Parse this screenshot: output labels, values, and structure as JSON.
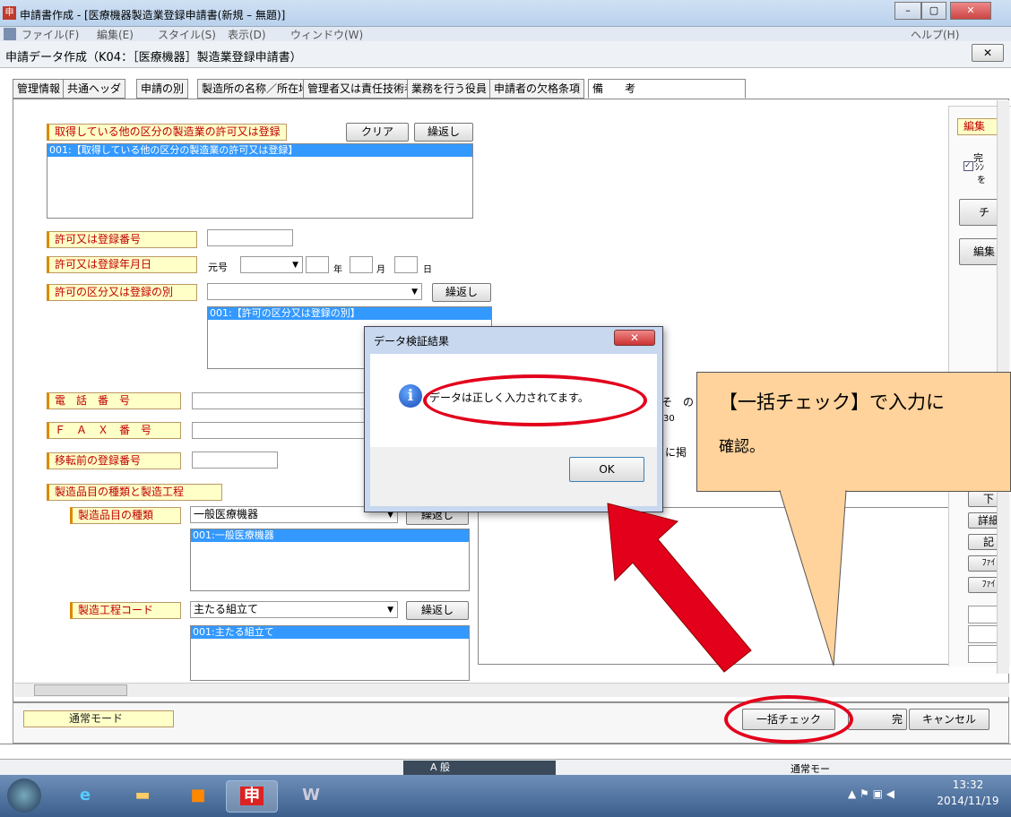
{
  "window": {
    "app_icon": "申",
    "title": "申請書作成 - [医療機器製造業登録申請書(新規 – 無題)]",
    "minimize": "–",
    "maximize": "▢",
    "close": "✕"
  },
  "menu": {
    "file": "ファイル(F)",
    "edit": "編集(E)",
    "style": "スタイル(S)",
    "view": "表示(D)",
    "window": "ウィンドウ(W)",
    "help": "ヘルプ(H)"
  },
  "subwindow": {
    "title": "申請データ作成（K04：［医療機器］製造業登録申請書）",
    "close": "✕"
  },
  "tabs": [
    "管理情報",
    "共通ヘッダ",
    "申請の別",
    "製造所の名称／所在地",
    "管理者又は責任技術者",
    "業務を行う役員",
    "申請者の欠格条項",
    "備　　考"
  ],
  "form": {
    "other_license_label": "取得している他の区分の製造業の許可又は登録",
    "clear_button": "クリア",
    "repeat_button": "繰返し",
    "other_license_item": "001:【取得している他の区分の製造業の許可又は登録】",
    "license_number_label": "許可又は登録番号",
    "license_date_label": "許可又は登録年月日",
    "era_label": "元号",
    "year_label": "年",
    "month_label": "月",
    "day_label": "日",
    "license_class_label": "許可の区分又は登録の別",
    "license_class_item": "001:【許可の区分又は登録の別】",
    "phone_label": "電　話　番　号",
    "fax_label": "Ｆ　Ａ　Ｘ　番　号",
    "prev_reg_label": "移転前の登録番号",
    "products_label": "製造品目の種類と製造工程",
    "product_type_label": "製造品目の種類",
    "product_type_value": "一般医療機器",
    "product_type_item": "001:一般医療機器",
    "process_code_label": "製造工程コード",
    "process_code_value": "主たる組立て",
    "process_code_item": "001:主たる組立て",
    "right_text_1": "そ　の",
    "right_text_2": "30",
    "right_text_3": "に掲"
  },
  "right_panel": {
    "edit_label": "編集",
    "complete_label": "完",
    "checkbox_text": "ｼﾝ",
    "checkbox_text2": "を",
    "button_1": "チ",
    "button_2": "編集",
    "button_3": "下",
    "button_4": "詳細",
    "button_5": "記",
    "button_6": "ﾌｧｲ",
    "button_7": "ﾌｧｲ"
  },
  "bottom": {
    "mode_label": "通常モード",
    "bulk_check_button": "一括チェック",
    "complete_button": "完",
    "cancel_button": "キャンセル"
  },
  "dialog": {
    "title": "データ検証結果",
    "message": "データは正しく入力されてます。",
    "ok_button": "OK"
  },
  "callout": {
    "line1": "【一括チェック】で入力に",
    "line2": "確認。"
  },
  "status_bar": {
    "mode": "通常モー",
    "ime": "A 般"
  },
  "taskbar": {
    "clock_time": "13:32",
    "clock_date": "2014/11/19"
  },
  "colors": {
    "highlight_red": "#e3001b",
    "callout_fill": "#ffd39b",
    "selection_blue": "#3399ff",
    "label_text": "#c00000"
  }
}
